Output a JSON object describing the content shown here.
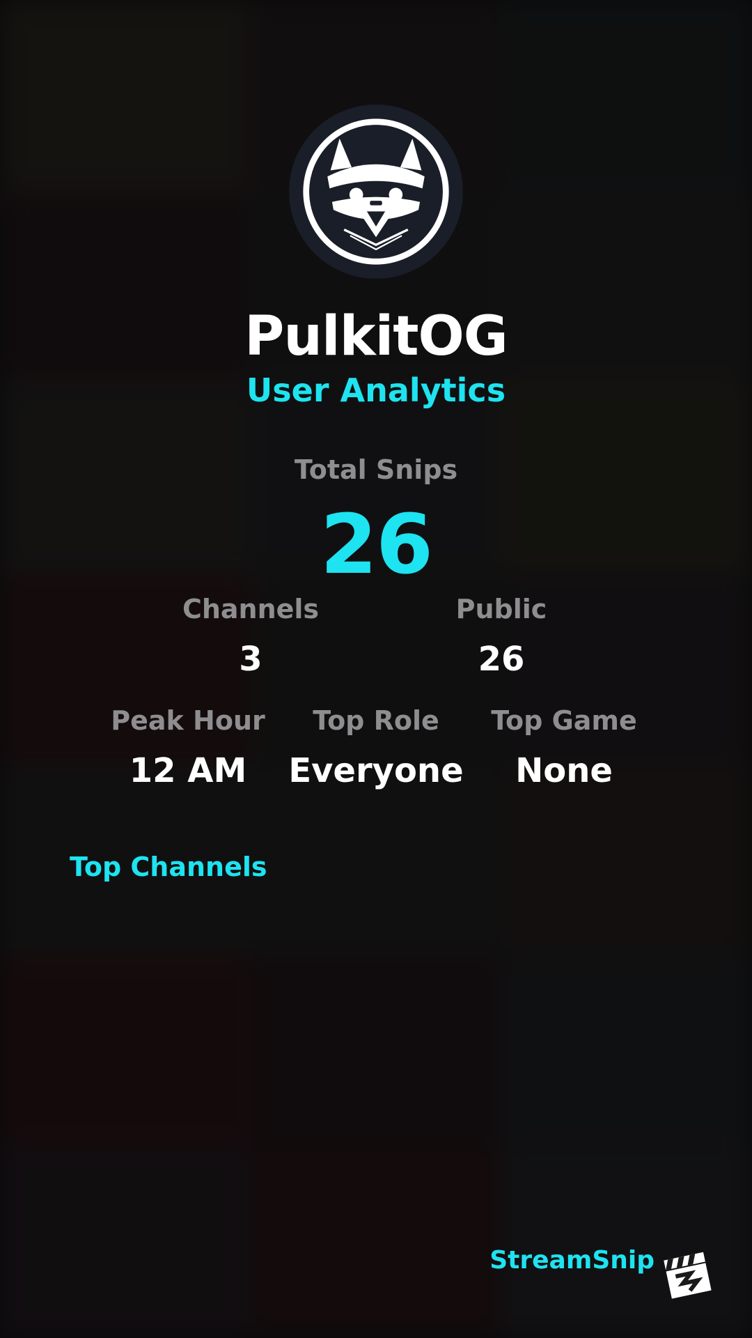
{
  "profile": {
    "username": "PulkitOG",
    "subtitle": "User Analytics",
    "avatar_icon": "raccoon-mascot-icon"
  },
  "stats": {
    "total": {
      "label": "Total Snips",
      "value": "26"
    },
    "channels": {
      "label": "Channels",
      "value": "3"
    },
    "public": {
      "label": "Public",
      "value": "26"
    },
    "peak_hour": {
      "label": "Peak Hour",
      "value": "12 AM"
    },
    "top_role": {
      "label": "Top Role",
      "value": "Everyone"
    },
    "top_game": {
      "label": "Top Game",
      "value": "None"
    }
  },
  "sections": {
    "top_channels_title": "Top Channels"
  },
  "brand": {
    "name": "StreamSnip",
    "logo_icon": "clapperboard-icon"
  },
  "colors": {
    "accent": "#1ee3f0",
    "label": "#8e8e90",
    "value": "#ffffff",
    "background": "#0c0c0e"
  }
}
